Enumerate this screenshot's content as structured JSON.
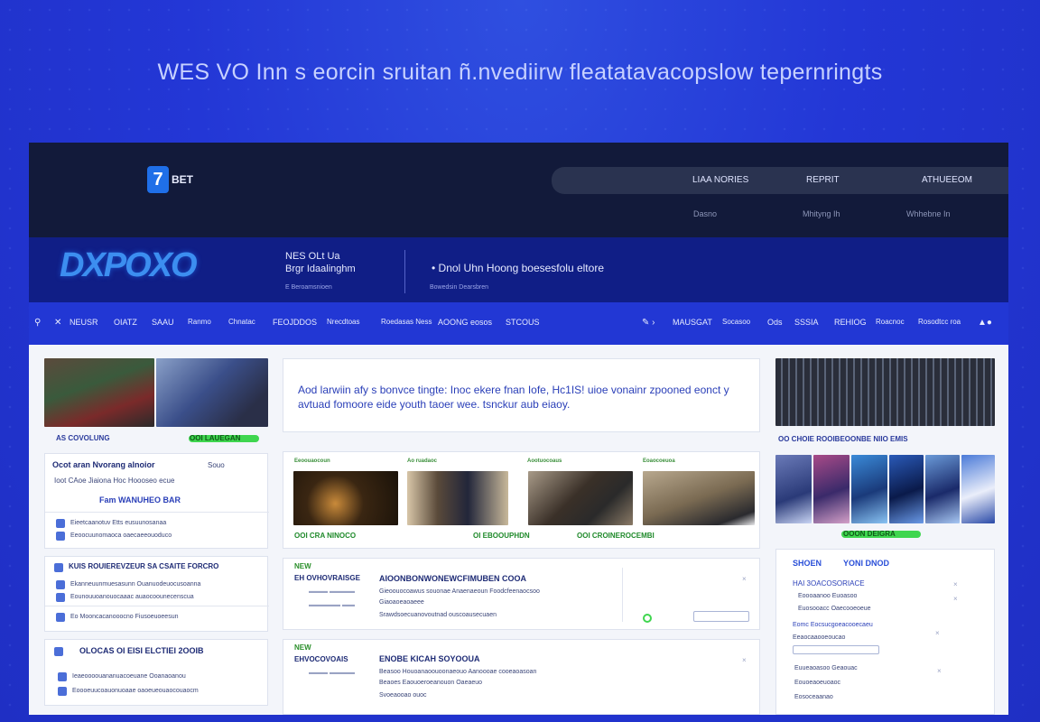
{
  "headline": "WES VO Inn s eorcin sruitan ñ.nvediirw fleatatavacopslow tepernringts",
  "topbar": {
    "logo_mark": "7",
    "logo_text": "BET",
    "nav": [
      "LIAA NORIES",
      "REPRIT",
      "ATHUEEOM"
    ],
    "subnav": [
      "Dasno",
      "Mhityng Ih",
      "Whhebne In"
    ]
  },
  "banner": {
    "logo_word": "DXPOXO",
    "text1_line1": "NES OLt Ua",
    "text1_line2": "Brgr Idaalinghm",
    "text1_small": "E Beroamsnioen",
    "text2": "• Dnol Uhn Hoong boesesfolu eltore",
    "text2_small": "Bowedsin Dearsbren"
  },
  "menu": {
    "left": [
      "NEUSR",
      "OIATZ",
      "SAAU",
      "Ranmo",
      "Chnatac",
      "FEOJDDOS",
      "Nrecdtoas",
      "Roedasas Ness",
      "AOONG eosos",
      "STCOUS"
    ],
    "right": [
      "MAUSGAT",
      "Socasoo",
      "Ods",
      "SSSIA",
      "REHIOG",
      "Roacnoc",
      "Rosodtcc roa"
    ]
  },
  "colors": {
    "accent": "#2237d4",
    "topbar": "#121a3a",
    "banner": "#101e86",
    "badge_green": "#3fd64f"
  },
  "left_col": {
    "tile_label": "AS COVOLUNG",
    "tile_badge": "OOI LAUEGAN",
    "box1_title": "Ocot aran Nvorang alnoior",
    "box1_tag": "Souo",
    "box1_row": "Ioot CAoe  Jiaiona  Hoc Hoooseo  ecue",
    "box1_sub": "Fam WANUHEO BAR",
    "box1_items": [
      "Eieetcaanotuv  Etts eusuunosanaa",
      "Eeoocuunomaoca  oaecaeeouoduco"
    ],
    "box2_title": "KUIS ROUIEREVZEUR SA CSAITE FORCRO",
    "box2_items": [
      "Ekanneuunmuesasunn  Ouanuodeuocusoanna",
      "Eounouuoanouocaaac  auaocoounecenscua",
      "Eo Mooncacanooocno  Fiusoeuoeesun"
    ],
    "box3_title": "OLOCAS OI EISI ELCTIEI 2OOIB",
    "box3_items": [
      "Ieaeoooouananuacoeuane  Ooanaoanou",
      "Eoooeuucoauonuoaae  oaoeueouaocouaocm"
    ]
  },
  "mid_col": {
    "intro_line1": "Aod larwiin afy s bonvce tingte: Inoc ekere fnan Iofe, Hc1IS! uioe vonainr zpooned eonct y",
    "intro_line2": "avtuad fomoore eide youth taoer wee. tsnckur  aub eiaoy.",
    "media_labels": [
      "Eeoouaocoun",
      "Ao ruadaoc",
      "Aootuocoaus",
      "Eoaocoeuoa"
    ],
    "media_footer_left": "OOI CRA NINOCO",
    "media_footer_mid": "OI EBOOUPHDN",
    "media_footer_right": "OOI CROINEROCEMBI",
    "feed1_label": "NEW",
    "feed1_sub": "EH OVHOVRAISGE",
    "feed1_title": "AIOONBONWONEWCFIMUBEN COOA",
    "feed1_line1": "Gieoouocoawus souonae Anaenaeoun Foodcfeenaocsoo",
    "feed1_line2": "Giaoaoeaoaeee",
    "feed1_line3": "Srawdsoecuanovoutnad  ouscoausecuaen",
    "feed2_label": "NEW",
    "feed2_sub": "EHVOCOVOAIS",
    "feed2_title": "ENOBE KICAH SOYOOUA",
    "feed2_line1": "Beasoo Houoanaoouoonaeouo Aanoooae cooeaoasoan",
    "feed2_line2": "Beaoes Eaouoeroeanouon  Oaeaeuo",
    "feed2_line3": "Svoeaooao ouoc"
  },
  "right_col": {
    "tile_label": "OO CHOIE ROOIBEOONBE NIIO EMIS",
    "gallery_badge": "OOON DEIGRA",
    "box_title": "SHOEN",
    "box_tag": "YONI DNOD",
    "box_items": [
      "HAI 3OACOSORIACE",
      "Eoooaanoo Euoasoo",
      "Euosooacc  Oaecooeoeue",
      "Eomc Eocsucgoeacooecaeu",
      "Eeaocaaooeoucao",
      "Euueaoasoo Geaouac",
      "Eouoeaoeuoaoc",
      "Eosoceaanao"
    ]
  }
}
